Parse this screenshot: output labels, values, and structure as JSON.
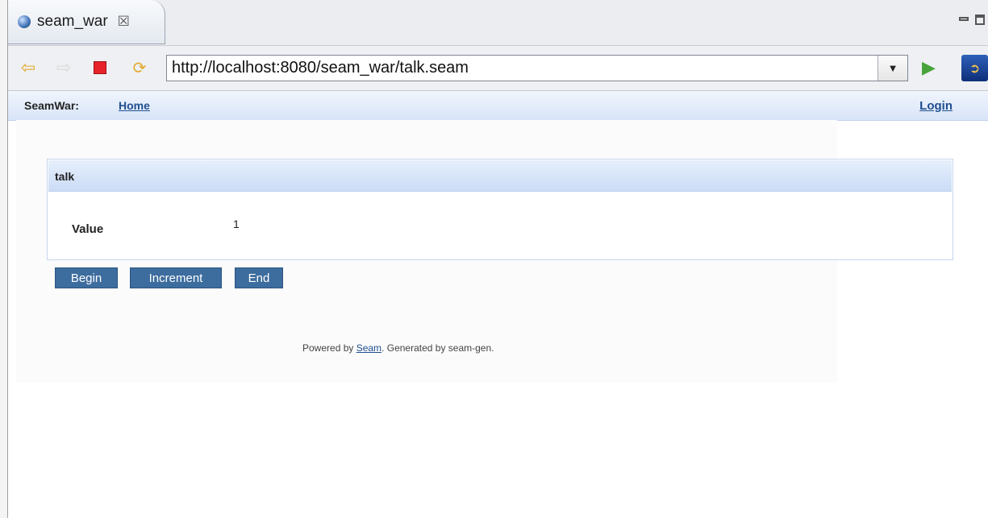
{
  "editor_tab": {
    "title": "seam_war",
    "close_glyph": "☒",
    "icon": "globe-icon"
  },
  "toolbar": {
    "back_icon": "back-arrow-icon",
    "forward_icon": "forward-arrow-icon",
    "stop_icon": "stop-icon",
    "refresh_icon": "refresh-icon",
    "url": "http://localhost:8080/seam_war/talk.seam",
    "dropdown_glyph": "▼",
    "go_glyph": "▶",
    "go_icon": "go-icon"
  },
  "page": {
    "menu": {
      "brand": "SeamWar:",
      "home": "Home",
      "login": "Login"
    },
    "panel": {
      "title": "talk",
      "field_label": "Value",
      "field_value": "1"
    },
    "buttons": {
      "begin": "Begin",
      "increment": "Increment",
      "end": "End"
    },
    "footer": {
      "prefix": "Powered by ",
      "link": "Seam",
      "suffix": ". Generated by seam-gen."
    }
  },
  "colors": {
    "button_bg": "#3d6d9e",
    "link": "#1f4f8f",
    "header_gradient_top": "#e6effc",
    "header_gradient_bottom": "#cbdcf6"
  }
}
